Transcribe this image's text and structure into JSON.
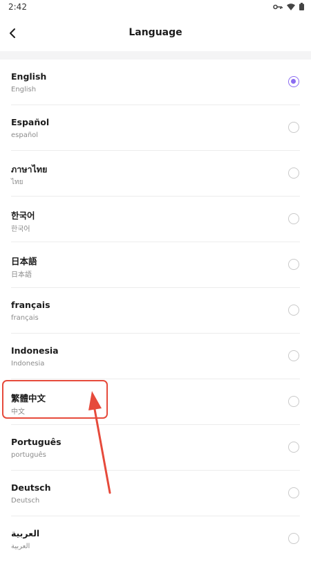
{
  "status_bar": {
    "time": "2:42"
  },
  "header": {
    "title": "Language",
    "back_icon": "chevron-left-icon"
  },
  "colors": {
    "accent": "#8b6cf1",
    "annotation": "#e64a3b"
  },
  "languages": [
    {
      "name": "English",
      "native": "English",
      "selected": true
    },
    {
      "name": "Español",
      "native": "español",
      "selected": false
    },
    {
      "name": "ภาษาไทย",
      "native": "ไทย",
      "selected": false
    },
    {
      "name": "한국어",
      "native": "한국어",
      "selected": false
    },
    {
      "name": "日本語",
      "native": "日本語",
      "selected": false
    },
    {
      "name": "français",
      "native": "français",
      "selected": false
    },
    {
      "name": "Indonesia",
      "native": "Indonesia",
      "selected": false
    },
    {
      "name": "繁體中文",
      "native": "中文",
      "selected": false
    },
    {
      "name": "Português",
      "native": "português",
      "selected": false
    },
    {
      "name": "Deutsch",
      "native": "Deutsch",
      "selected": false
    },
    {
      "name": "العربية",
      "native": "العربية",
      "selected": false
    }
  ]
}
